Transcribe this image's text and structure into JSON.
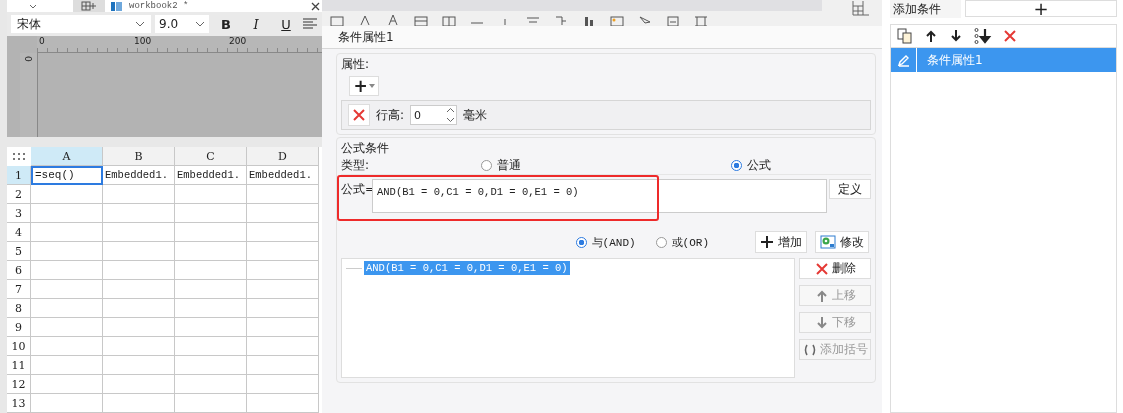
{
  "editor": {
    "tab": {
      "title": "workbook2 *"
    },
    "font_toolbar": {
      "font": "宋体",
      "size": "9.0",
      "buttons": [
        "B",
        "I",
        "U"
      ]
    },
    "ruler": {
      "top_labels": [
        "0",
        "100",
        "200"
      ],
      "left_label": "0"
    },
    "grid": {
      "columns": [
        {
          "label": "A",
          "selected": true
        },
        {
          "label": "B",
          "selected": false
        },
        {
          "label": "C",
          "selected": false
        },
        {
          "label": "D",
          "selected": false
        }
      ],
      "rows": [
        {
          "header": "1",
          "selected": true,
          "cells": [
            {
              "text": "=seq()",
              "selected": true
            },
            {
              "text": "Embedded1.",
              "selected": false
            },
            {
              "text": "Embedded1.",
              "selected": false
            },
            {
              "text": "Embedded1.",
              "selected": false
            }
          ]
        },
        {
          "header": "2",
          "selected": false
        },
        {
          "header": "3",
          "selected": false
        },
        {
          "header": "4",
          "selected": false
        },
        {
          "header": "5",
          "selected": false
        },
        {
          "header": "6",
          "selected": false
        },
        {
          "header": "7",
          "selected": false
        },
        {
          "header": "8",
          "selected": false
        },
        {
          "header": "9",
          "selected": false
        },
        {
          "header": "10",
          "selected": false
        },
        {
          "header": "11",
          "selected": false
        },
        {
          "header": "12",
          "selected": false
        },
        {
          "header": "13",
          "selected": false
        }
      ]
    }
  },
  "dialog": {
    "title": "条件属性1",
    "properties": {
      "legend": "属性:",
      "add_button": "+",
      "items": [
        {
          "label": "行高:",
          "value": "0",
          "unit": "毫米"
        }
      ]
    },
    "formula_condition": {
      "legend": "公式条件",
      "type_label": "类型:",
      "types": [
        {
          "label": "普通",
          "selected": false
        },
        {
          "label": "公式",
          "selected": true
        }
      ],
      "formula": {
        "label": "公式=",
        "value": "AND(B1 = 0,C1 = 0,D1 = 0,E1 = 0)",
        "highlighted": true
      },
      "define_button": "定义",
      "joins": [
        {
          "label": "与(AND)",
          "selected": true
        },
        {
          "label": "或(OR)",
          "selected": false
        }
      ],
      "add_button": "增加",
      "modify_button": "修改",
      "conditions": [
        {
          "text": "AND(B1 = 0,C1 = 0,D1 = 0,E1 = 0)",
          "selected": true
        }
      ],
      "side_buttons": [
        {
          "kind": "delete",
          "label": "删除",
          "disabled": false
        },
        {
          "kind": "up",
          "label": "上移",
          "disabled": true
        },
        {
          "kind": "down",
          "label": "下移",
          "disabled": true
        },
        {
          "kind": "bracket",
          "label": "添加括号",
          "disabled": true
        }
      ]
    }
  },
  "conditions_panel": {
    "tab": "添加条件",
    "add_button": "+",
    "items": [
      {
        "label": "条件属性1",
        "selected": true
      }
    ]
  }
}
